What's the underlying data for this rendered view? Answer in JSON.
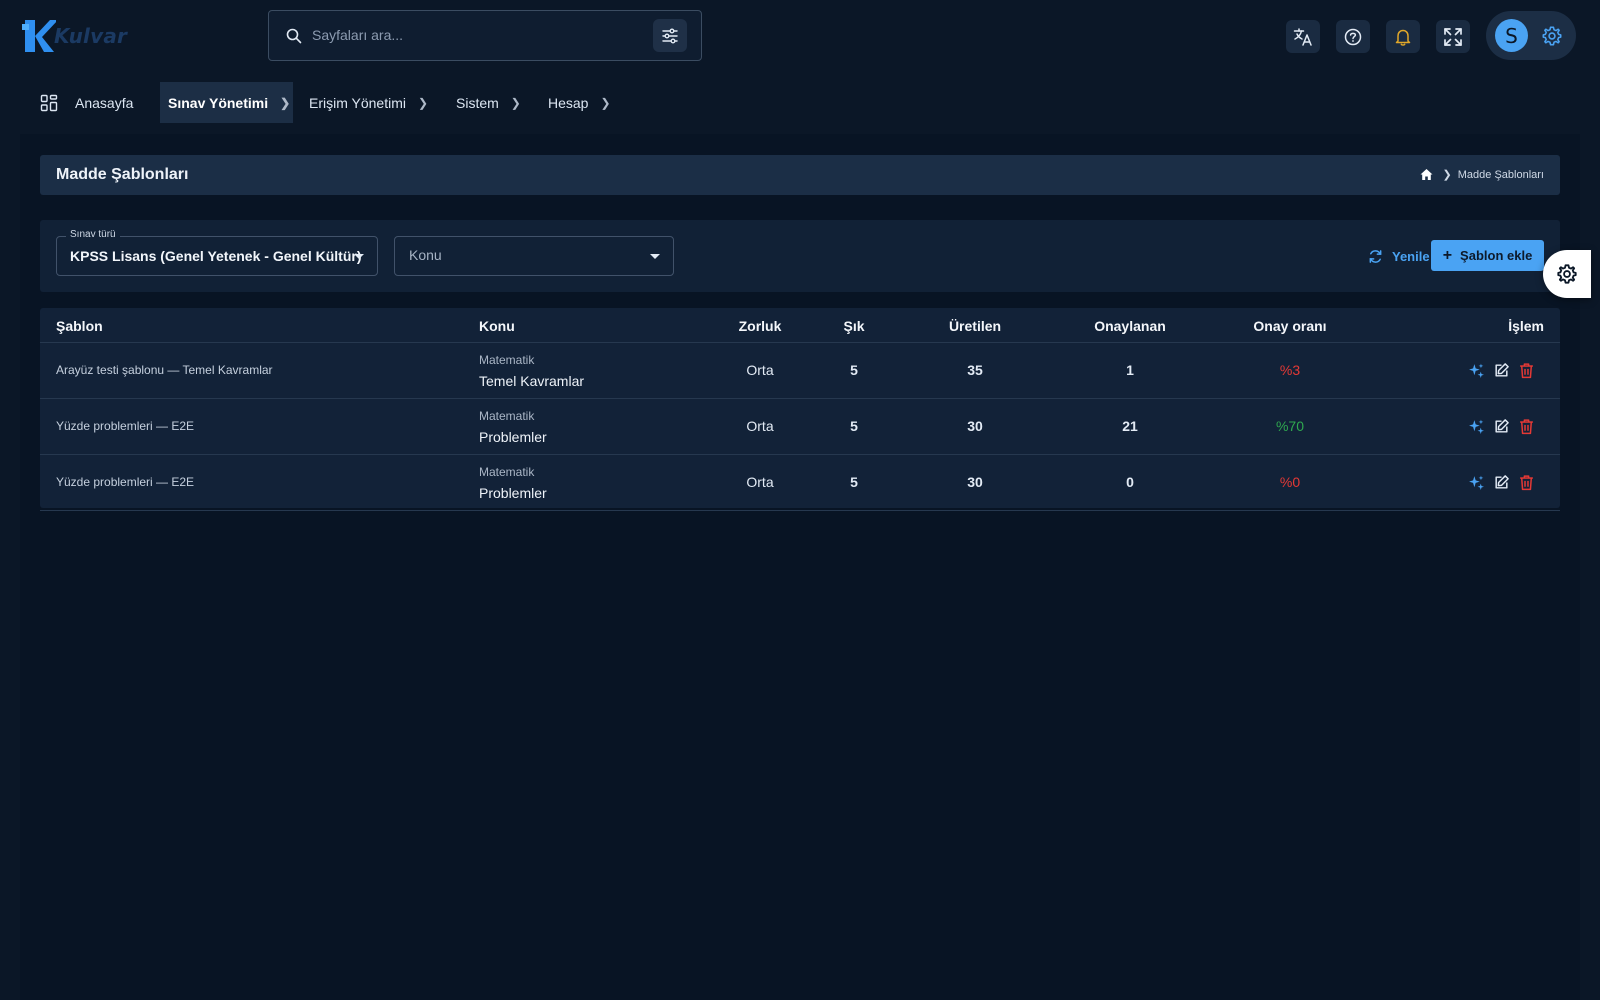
{
  "brand": {
    "name": "Kulvar",
    "colors": {
      "accent": "#4aa3f3",
      "danger": "#e53935",
      "success": "#2fa84f"
    }
  },
  "search": {
    "placeholder": "Sayfaları ara...",
    "value": ""
  },
  "topbar": {
    "icons": [
      "translate-icon",
      "help-icon",
      "bell-icon",
      "fullscreen-icon",
      "gear-icon"
    ],
    "avatar_letter": "S"
  },
  "nav": {
    "items": [
      {
        "label": "Anasayfa",
        "icon": "dashboard-icon"
      },
      {
        "label": "Sınav Yönetimi",
        "active": true
      },
      {
        "label": "Erişim Yönetimi"
      },
      {
        "label": "Sistem"
      },
      {
        "label": "Hesap"
      }
    ]
  },
  "page": {
    "title": "Madde Şablonları",
    "breadcrumb": [
      "home-icon",
      "Madde Şablonları"
    ]
  },
  "filters": {
    "exam_type": {
      "legend": "Sınav türü",
      "value": "KPSS Lisans (Genel Yetenek - Genel Kültür)"
    },
    "topic": {
      "placeholder": "Konu"
    },
    "refresh_label": "Yenile",
    "add_label": "Şablon ekle"
  },
  "table": {
    "headers": {
      "template": "Şablon",
      "topic": "Konu",
      "difficulty": "Zorluk",
      "choices": "Şık",
      "generated": "Üretilen",
      "approved": "Onaylanan",
      "rate": "Onay oranı",
      "actions": "İşlem"
    },
    "rows": [
      {
        "name": "Arayüz testi şablonu — Temel Kavramlar",
        "subject": "Matematik",
        "topic": "Temel Kavramlar",
        "difficulty": "Orta",
        "choices": "5",
        "generated": "35",
        "approved": "1",
        "rate": "%3",
        "rate_status": "low"
      },
      {
        "name": "Yüzde problemleri — E2E",
        "subject": "Matematik",
        "topic": "Problemler",
        "difficulty": "Orta",
        "choices": "5",
        "generated": "30",
        "approved": "21",
        "rate": "%70",
        "rate_status": "high"
      },
      {
        "name": "Yüzde problemleri — E2E",
        "subject": "Matematik",
        "topic": "Problemler",
        "difficulty": "Orta",
        "choices": "5",
        "generated": "30",
        "approved": "0",
        "rate": "%0",
        "rate_status": "low"
      }
    ],
    "row_actions": [
      "sparkle-icon",
      "edit-icon",
      "trash-icon"
    ]
  }
}
